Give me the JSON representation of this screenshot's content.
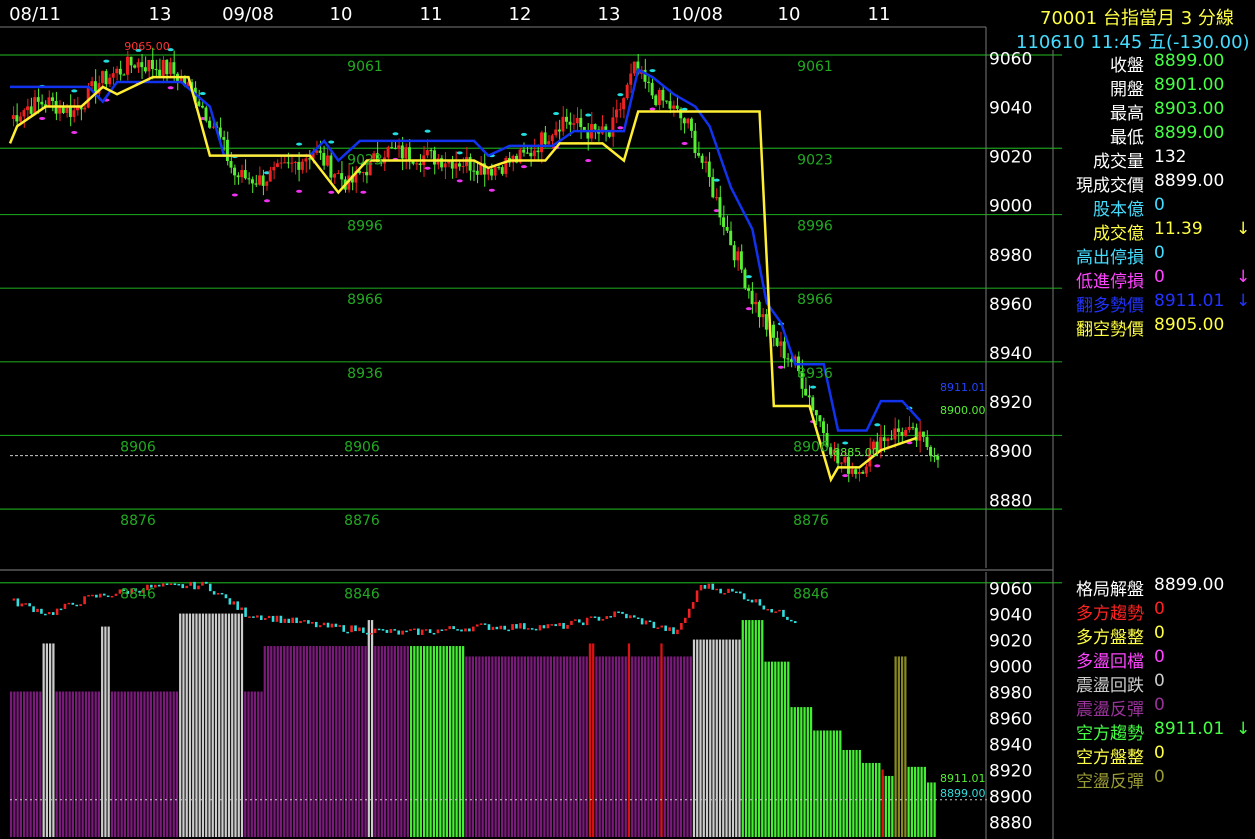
{
  "header": {
    "symbol_title": "70001  台指當月 3 分線",
    "datetime_change": "110610 11:45 五(-130.00)"
  },
  "info_top": [
    {
      "label": "收盤",
      "value": "8899.00",
      "label_color": "#ffffff",
      "value_color": "#44ff44",
      "arrow": ""
    },
    {
      "label": "開盤",
      "value": "8901.00",
      "label_color": "#ffffff",
      "value_color": "#44ff44",
      "arrow": ""
    },
    {
      "label": "最高",
      "value": "8903.00",
      "label_color": "#ffffff",
      "value_color": "#44ff44",
      "arrow": ""
    },
    {
      "label": "最低",
      "value": "8899.00",
      "label_color": "#ffffff",
      "value_color": "#44ff44",
      "arrow": ""
    },
    {
      "label": "成交量",
      "value": "132",
      "label_color": "#ffffff",
      "value_color": "#ffffff",
      "arrow": ""
    },
    {
      "label": "現成交價",
      "value": "8899.00",
      "label_color": "#ffffff",
      "value_color": "#ffffff",
      "arrow": ""
    },
    {
      "label": "股本億",
      "value": "0",
      "label_color": "#44ddff",
      "value_color": "#44ddff",
      "arrow": ""
    },
    {
      "label": "成交億",
      "value": "11.39",
      "label_color": "#ffff44",
      "value_color": "#ffff44",
      "arrow": "↓"
    },
    {
      "label": "高出停損",
      "value": "0",
      "label_color": "#44ddff",
      "value_color": "#44ddff",
      "arrow": ""
    },
    {
      "label": "低進停損",
      "value": "0",
      "label_color": "#ff44ff",
      "value_color": "#ff44ff",
      "arrow": "↓"
    },
    {
      "label": "翻多勢價",
      "value": "8911.01",
      "label_color": "#2233ff",
      "value_color": "#2233ff",
      "arrow": "↓"
    },
    {
      "label": "翻空勢價",
      "value": "8905.00",
      "label_color": "#ffff44",
      "value_color": "#ffff44",
      "arrow": ""
    }
  ],
  "info_bottom": [
    {
      "label": "格局解盤",
      "value": "8899.00",
      "label_color": "#ffffff",
      "value_color": "#ffffff",
      "arrow": ""
    },
    {
      "label": "多方趨勢",
      "value": "0",
      "label_color": "#ff2222",
      "value_color": "#ff2222",
      "arrow": ""
    },
    {
      "label": "多方盤整",
      "value": "0",
      "label_color": "#ffff44",
      "value_color": "#ffff44",
      "arrow": ""
    },
    {
      "label": "多盪回檔",
      "value": "0",
      "label_color": "#ff44ff",
      "value_color": "#ff44ff",
      "arrow": ""
    },
    {
      "label": "震盪回跌",
      "value": "0",
      "label_color": "#cccccc",
      "value_color": "#cccccc",
      "arrow": ""
    },
    {
      "label": "震盪反彈",
      "value": "0",
      "label_color": "#993399",
      "value_color": "#993399",
      "arrow": ""
    },
    {
      "label": "空方趨勢",
      "value": "8911.01",
      "label_color": "#44ff44",
      "value_color": "#44ff44",
      "arrow": "↓"
    },
    {
      "label": "空方盤整",
      "value": "0",
      "label_color": "#ffff44",
      "value_color": "#ffff44",
      "arrow": ""
    },
    {
      "label": "空盪反彈",
      "value": "0",
      "label_color": "#999933",
      "value_color": "#999933",
      "arrow": ""
    }
  ],
  "chart_data": {
    "type": "candlestick",
    "x_tick_labels": [
      "08/11",
      "13",
      "09/08",
      "10",
      "11",
      "12",
      "13",
      "10/08",
      "10",
      "11"
    ],
    "main_y_ticks": [
      9060,
      9040,
      9020,
      9000,
      8980,
      8960,
      8940,
      8920,
      8900,
      8880
    ],
    "main_ylim": [
      8852,
      9072
    ],
    "sub_y_ticks": [
      9060,
      9040,
      9020,
      9000,
      8980,
      8960,
      8940,
      8920,
      8900,
      8880
    ],
    "sub_ylim": [
      8868,
      9072
    ],
    "level_labels": [
      "9061",
      "9023",
      "8996",
      "8966",
      "8936",
      "8906",
      "8876",
      "8846"
    ],
    "level_values": [
      9061,
      9023,
      8996,
      8966,
      8936,
      8906,
      8876,
      8846
    ],
    "annotations": {
      "session_high": "9065.00",
      "session_low": "8885.00",
      "main_right_top": "8911.01",
      "main_right_bottom": "8900.00",
      "sub_right_top": "8911.01",
      "sub_right_bottom": "8899.00"
    },
    "last_price": 8899,
    "close_path": [
      [
        0,
        9035
      ],
      [
        5,
        9040
      ],
      [
        10,
        9042
      ],
      [
        18,
        9038
      ],
      [
        25,
        9050
      ],
      [
        35,
        9058
      ],
      [
        45,
        9055
      ],
      [
        52,
        9045
      ],
      [
        58,
        9030
      ],
      [
        63,
        9012
      ],
      [
        70,
        9010
      ],
      [
        78,
        9015
      ],
      [
        85,
        9022
      ],
      [
        95,
        9008
      ],
      [
        105,
        9022
      ],
      [
        115,
        9020
      ],
      [
        125,
        9018
      ],
      [
        135,
        9015
      ],
      [
        145,
        9020
      ],
      [
        150,
        9028
      ],
      [
        155,
        9035
      ],
      [
        162,
        9030
      ],
      [
        168,
        9028
      ],
      [
        175,
        9055
      ],
      [
        180,
        9045
      ],
      [
        185,
        9040
      ],
      [
        190,
        9032
      ],
      [
        196,
        9010
      ],
      [
        202,
        8985
      ],
      [
        208,
        8962
      ],
      [
        214,
        8945
      ],
      [
        220,
        8935
      ],
      [
        226,
        8915
      ],
      [
        232,
        8895
      ],
      [
        238,
        8892
      ],
      [
        244,
        8905
      ],
      [
        250,
        8908
      ],
      [
        255,
        8904
      ],
      [
        260,
        8899
      ]
    ],
    "blue_line": [
      [
        0,
        9048
      ],
      [
        22,
        9048
      ],
      [
        26,
        9042
      ],
      [
        30,
        9050
      ],
      [
        48,
        9050
      ],
      [
        52,
        9045
      ],
      [
        56,
        9040
      ],
      [
        60,
        9020
      ],
      [
        84,
        9020
      ],
      [
        88,
        9026
      ],
      [
        92,
        9018
      ],
      [
        98,
        9026
      ],
      [
        130,
        9026
      ],
      [
        134,
        9020
      ],
      [
        140,
        9024
      ],
      [
        152,
        9024
      ],
      [
        158,
        9030
      ],
      [
        172,
        9030
      ],
      [
        176,
        9055
      ],
      [
        180,
        9052
      ],
      [
        186,
        9045
      ],
      [
        192,
        9040
      ],
      [
        196,
        9032
      ],
      [
        202,
        9007
      ],
      [
        208,
        8990
      ],
      [
        212,
        8960
      ],
      [
        216,
        8952
      ],
      [
        220,
        8935
      ],
      [
        228,
        8935
      ],
      [
        232,
        8908
      ],
      [
        240,
        8908
      ],
      [
        244,
        8920
      ],
      [
        250,
        8920
      ],
      [
        255,
        8912
      ]
    ],
    "yellow_line": [
      [
        0,
        9025
      ],
      [
        2,
        9032
      ],
      [
        10,
        9040
      ],
      [
        20,
        9040
      ],
      [
        26,
        9048
      ],
      [
        30,
        9045
      ],
      [
        40,
        9052
      ],
      [
        50,
        9052
      ],
      [
        56,
        9020
      ],
      [
        84,
        9020
      ],
      [
        92,
        9005
      ],
      [
        100,
        9018
      ],
      [
        130,
        9018
      ],
      [
        134,
        9015
      ],
      [
        140,
        9018
      ],
      [
        150,
        9018
      ],
      [
        154,
        9025
      ],
      [
        166,
        9025
      ],
      [
        172,
        9018
      ],
      [
        176,
        9038
      ],
      [
        186,
        9038
      ],
      [
        190,
        9038
      ],
      [
        210,
        9038
      ],
      [
        214,
        8918
      ],
      [
        224,
        8918
      ],
      [
        230,
        8888
      ],
      [
        232,
        8893
      ],
      [
        238,
        8893
      ],
      [
        244,
        8900
      ],
      [
        254,
        8905
      ]
    ]
  }
}
